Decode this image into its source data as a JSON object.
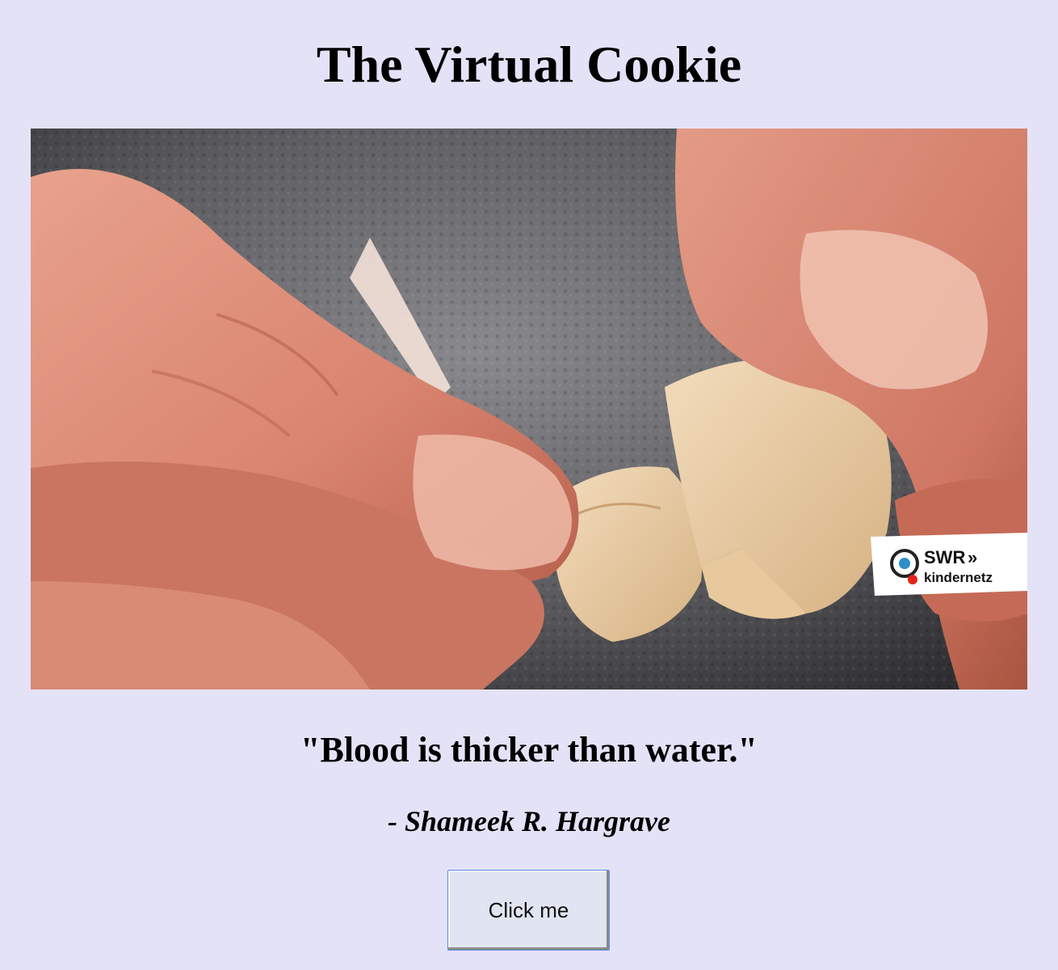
{
  "page": {
    "title": "The Virtual Cookie"
  },
  "image": {
    "description_label": "Hands breaking a fortune cookie",
    "watermark_brand": "SWR",
    "watermark_sub": "kindernetz"
  },
  "fortune": {
    "quote": "\"Blood is thicker than water.\"",
    "author": "- Shameek R. Hargrave"
  },
  "actions": {
    "click_label": "Click me"
  },
  "colors": {
    "background": "#e4e2f7",
    "button_bg": "#e1e5f2",
    "button_border": "#5b8edb"
  }
}
